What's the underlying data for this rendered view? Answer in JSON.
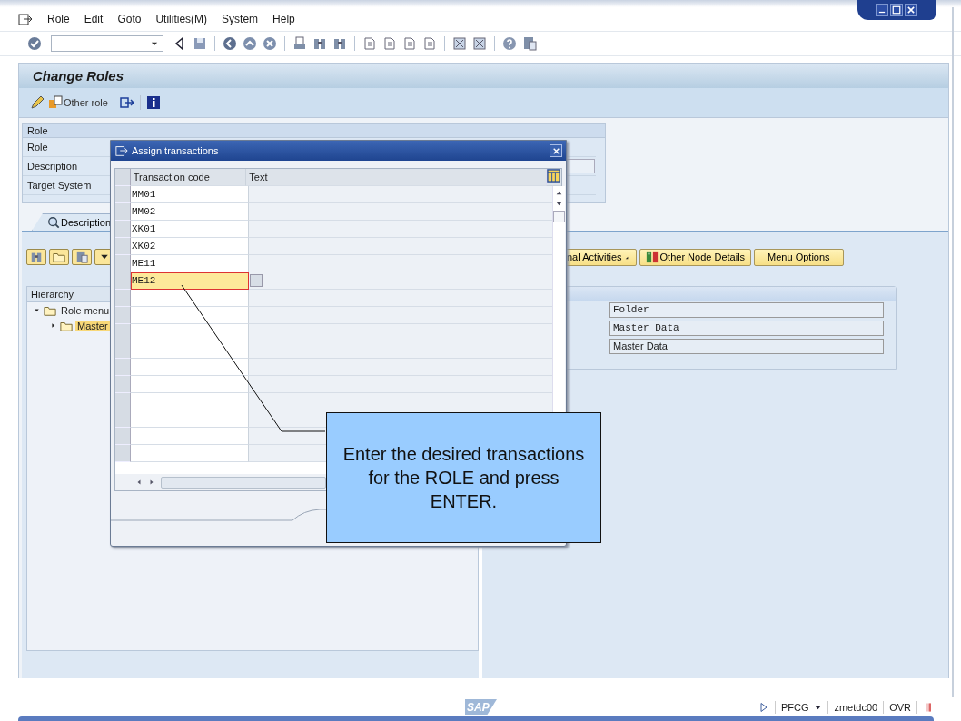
{
  "menu": [
    {
      "label": "Role"
    },
    {
      "label": "Edit"
    },
    {
      "label": "Goto"
    },
    {
      "label": "Utilities(M)"
    },
    {
      "label": "System"
    },
    {
      "label": "Help"
    }
  ],
  "title": "Change Roles",
  "app_toolbar": {
    "other_role": "Other role"
  },
  "role_group": {
    "title": "Role",
    "labels": [
      "Role",
      "Description",
      "Target System"
    ]
  },
  "tabs": [
    {
      "label": "Description",
      "selected": true
    }
  ],
  "menu_buttons": [
    {
      "label": "nal Activities",
      "dropdown": true
    },
    {
      "label": "Other Node Details",
      "dropdown": false
    },
    {
      "label": "Menu Options",
      "dropdown": false
    }
  ],
  "hierarchy": {
    "title": "Hierarchy",
    "nodes": [
      {
        "label": "Role menu",
        "expanded": true,
        "selected": false,
        "children": [
          {
            "label": "Master",
            "expanded": false,
            "selected": true
          }
        ]
      }
    ]
  },
  "node_details": [
    {
      "value": "Folder",
      "kind": "mono"
    },
    {
      "value": "Master Data",
      "kind": "mono"
    },
    {
      "value": "Master Data",
      "kind": "text"
    }
  ],
  "dialog": {
    "title": "Assign transactions",
    "columns": [
      "Transaction code",
      "Text"
    ],
    "rows": [
      {
        "code": "MM01",
        "selected": false
      },
      {
        "code": "MM02",
        "selected": false
      },
      {
        "code": "XK01",
        "selected": false
      },
      {
        "code": "XK02",
        "selected": false
      },
      {
        "code": "ME11",
        "selected": false
      },
      {
        "code": "ME12",
        "selected": true
      }
    ]
  },
  "callout": {
    "text": "Enter the desired transactions for the ROLE and press ENTER."
  },
  "status_bar": {
    "logo": "SAP",
    "items": [
      "PFCG",
      "zmetdc00",
      "OVR"
    ]
  }
}
